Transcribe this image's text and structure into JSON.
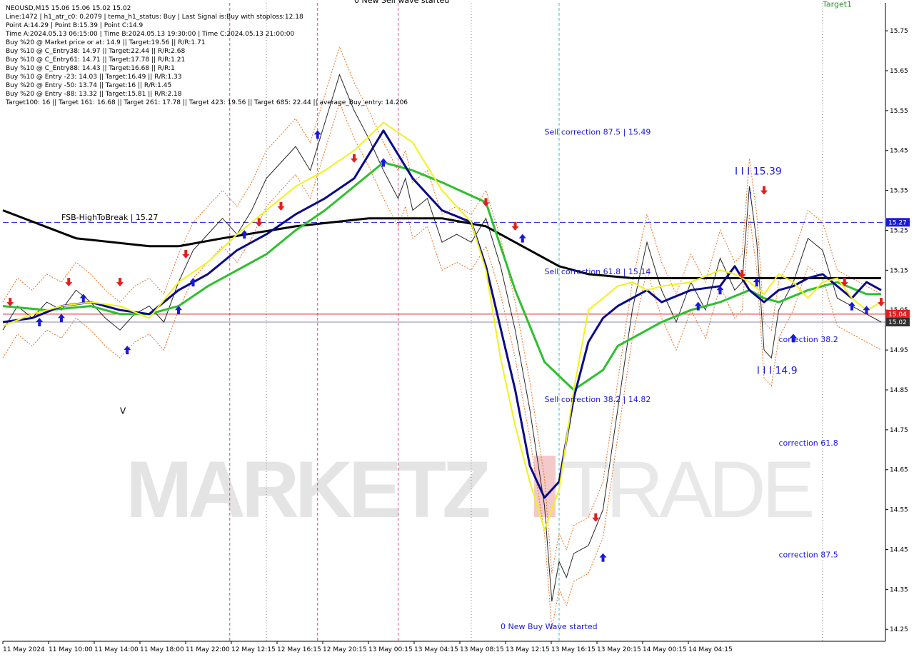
{
  "chart_data": {
    "type": "line",
    "symbol_header": "NEOUSD,M15  15.06 15.06 15.02 15.02",
    "info_lines": [
      "Line:1472 | h1_atr_c0: 0.2079 | tema_h1_status: Buy | Last Signal is:Buy with stoploss:12.18",
      "Point A:14.29 | Point B:15.39 | Point C:14.9",
      "Time A:2024.05.13 06:15:00 | Time B:2024.05.13 19:30:00 | Time C:2024.05.13 21:00:00",
      "Buy %20 @ Market price or at: 14.9 || Target:19.56 || R/R:1.71",
      "Buy %10 @ C_Entry38: 14.97 || Target:22.44 || R/R:2.68",
      "Buy %10 @ C_Entry61: 14.71 || Target:17.78 || R/R:1.21",
      "Buy %10 @ C_Entry88: 14.43 || Target:16.68 || R/R:1",
      "Buy %10 @ Entry -23: 14.03 || Target:16.49 || R/R:1.33",
      "Buy %20 @ Entry -50: 13.74 || Target:16 || R/R:1.45",
      "Buy %20 @ Entry -88: 13.32 || Target:15.81 || R/R:2.18",
      "Target100: 16 || Target 161: 16.68 || Target 261: 17.78 || Target 423: 19.56 || Target 685: 22.44 || average_Buy_entry: 14.206"
    ],
    "ylim": [
      14.22,
      15.82
    ],
    "y_ticks": [
      "15.75",
      "15.65",
      "15.55",
      "15.45",
      "15.35",
      "15.25",
      "15.15",
      "15.05",
      "14.95",
      "14.85",
      "14.75",
      "14.65",
      "14.55",
      "14.45",
      "14.35",
      "14.25"
    ],
    "x_ticks": [
      "11 May 2024",
      "11 May 10:00",
      "11 May 14:00",
      "11 May 18:00",
      "11 May 22:00",
      "12 May 12:15",
      "12 May 16:15",
      "12 May 20:15",
      "13 May 00:15",
      "13 May 04:15",
      "13 May 08:15",
      "13 May 12:15",
      "13 May 16:15",
      "13 May 20:15",
      "14 May 00:15",
      "14 May 04:15"
    ],
    "price_labels": [
      {
        "text": "15.27",
        "value": 15.27,
        "color": "#1a1ad6"
      },
      {
        "text": "15.04",
        "value": 15.04,
        "color": "#e02020"
      },
      {
        "text": "15.02",
        "value": 15.02,
        "color": "#303030"
      }
    ],
    "levels": [
      {
        "name": "FSB-HighToBreak",
        "value": 15.27,
        "color": "#1a1ad6",
        "style": "dashed"
      },
      {
        "name": "current-bid",
        "value": 15.04,
        "color": "#e02020",
        "style": "solid"
      },
      {
        "name": "current-ask",
        "value": 15.02,
        "color": "#8a8ab0",
        "style": "solid"
      }
    ],
    "annotations": [
      {
        "text": "0 New Sell wave started",
        "bar": 48,
        "value": 15.82,
        "color": "#000000"
      },
      {
        "text": "Target1",
        "bar": 112,
        "value": 15.81,
        "color": "#2e8b2e"
      },
      {
        "text": "Sell correction 87.5 | 15.49",
        "bar": 74,
        "value": 15.49,
        "color": "#1a1ad6"
      },
      {
        "text": "Sell correction 61.8 | 15.14",
        "bar": 74,
        "value": 15.14,
        "color": "#1a1ad6"
      },
      {
        "text": "Sell correction 38.2 | 14.82",
        "bar": 74,
        "value": 14.82,
        "color": "#1a1ad6"
      },
      {
        "text": "I I I 15.39",
        "bar": 100,
        "value": 15.39,
        "color": "#1a1ad6",
        "size": 14
      },
      {
        "text": "I",
        "bar": 102,
        "value": 15.33,
        "color": "#1a1ad6",
        "size": 12
      },
      {
        "text": "FSB-HighToBreak | 15.27",
        "bar": 8,
        "value": 15.276,
        "color": "#000000"
      },
      {
        "text": "correction 38.2",
        "bar": 106,
        "value": 14.97,
        "color": "#1a1ad6"
      },
      {
        "text": "I I I 14.9",
        "bar": 103,
        "value": 14.89,
        "color": "#1a1ad6",
        "size": 14
      },
      {
        "text": "correction 61.8",
        "bar": 106,
        "value": 14.71,
        "color": "#1a1ad6"
      },
      {
        "text": "correction 87.5",
        "bar": 106,
        "value": 14.43,
        "color": "#1a1ad6"
      },
      {
        "text": "0 New Buy Wave started",
        "bar": 68,
        "value": 14.25,
        "color": "#1a1ad6"
      },
      {
        "text": "V",
        "bar": 16,
        "value": 14.79,
        "color": "#000000",
        "size": 12
      }
    ],
    "watermark": {
      "left": "MARKETZ",
      "right": "TRADE"
    },
    "series": [
      {
        "name": "EMA-slow",
        "color": "#000000",
        "x": [
          0,
          10,
          20,
          24,
          30,
          40,
          50,
          56,
          60,
          66,
          72,
          76,
          80,
          86,
          90,
          94,
          100,
          106,
          112,
          118,
          120
        ],
        "y": [
          15.3,
          15.23,
          15.21,
          15.21,
          15.23,
          15.26,
          15.28,
          15.28,
          15.28,
          15.26,
          15.2,
          15.16,
          15.14,
          15.13,
          15.13,
          15.13,
          15.13,
          15.13,
          15.13,
          15.13,
          15.13
        ]
      },
      {
        "name": "EMA-mid",
        "color": "#2fbf2f",
        "x": [
          0,
          6,
          12,
          16,
          20,
          24,
          28,
          32,
          36,
          40,
          44,
          48,
          52,
          56,
          60,
          66,
          70,
          74,
          78,
          82,
          84,
          86,
          88,
          90,
          94,
          98,
          102,
          104,
          106,
          110,
          114,
          118,
          120
        ],
        "y": [
          15.06,
          15.05,
          15.06,
          15.04,
          15.04,
          15.06,
          15.11,
          15.15,
          15.19,
          15.25,
          15.3,
          15.36,
          15.42,
          15.4,
          15.37,
          15.32,
          15.1,
          14.92,
          14.85,
          14.9,
          14.96,
          14.98,
          15.0,
          15.02,
          15.05,
          15.07,
          15.1,
          15.08,
          15.07,
          15.1,
          15.12,
          15.09,
          15.09
        ]
      },
      {
        "name": "EMA-fast",
        "color": "#0a0a8a",
        "x": [
          0,
          4,
          8,
          12,
          16,
          20,
          24,
          28,
          32,
          36,
          40,
          44,
          48,
          52,
          56,
          60,
          64,
          66,
          70,
          72,
          74,
          76,
          78,
          80,
          82,
          84,
          86,
          88,
          90,
          94,
          98,
          100,
          102,
          104,
          106,
          108,
          110,
          112,
          114,
          116,
          118,
          120
        ],
        "y": [
          15.02,
          15.03,
          15.06,
          15.07,
          15.05,
          15.04,
          15.1,
          15.14,
          15.2,
          15.24,
          15.29,
          15.33,
          15.38,
          15.5,
          15.38,
          15.3,
          15.27,
          15.16,
          14.85,
          14.66,
          14.58,
          14.62,
          14.83,
          14.97,
          15.03,
          15.06,
          15.08,
          15.1,
          15.07,
          15.1,
          15.11,
          15.16,
          15.1,
          15.07,
          15.1,
          15.11,
          15.13,
          15.14,
          15.11,
          15.08,
          15.12,
          15.1
        ]
      },
      {
        "name": "TEMA",
        "color": "#f2f21a",
        "x": [
          0,
          4,
          8,
          12,
          16,
          20,
          24,
          28,
          32,
          36,
          40,
          44,
          48,
          52,
          56,
          60,
          64,
          66,
          68,
          70,
          72,
          74,
          76,
          78,
          80,
          82,
          84,
          86,
          88,
          90,
          94,
          98,
          100,
          102,
          104,
          106,
          108,
          110,
          112,
          114,
          116,
          118,
          120
        ],
        "y": [
          15.01,
          15.04,
          15.06,
          15.07,
          15.06,
          15.03,
          15.12,
          15.17,
          15.24,
          15.3,
          15.36,
          15.4,
          15.45,
          15.52,
          15.47,
          15.35,
          15.27,
          15.15,
          14.93,
          14.76,
          14.62,
          14.5,
          14.6,
          14.85,
          15.05,
          15.08,
          15.11,
          15.12,
          15.1,
          15.11,
          15.12,
          15.15,
          15.14,
          15.12,
          15.09,
          15.14,
          15.12,
          15.08,
          15.12,
          15.13,
          15.08,
          15.05,
          15.07
        ]
      }
    ],
    "price_path": {
      "name": "price",
      "color": "#000000",
      "x": [
        0,
        2,
        4,
        6,
        8,
        10,
        12,
        14,
        16,
        18,
        20,
        22,
        24,
        26,
        28,
        30,
        32,
        34,
        36,
        38,
        40,
        42,
        44,
        46,
        48,
        50,
        52,
        54,
        55,
        56,
        58,
        60,
        62,
        64,
        66,
        68,
        70,
        72,
        74,
        75,
        76,
        77,
        78,
        80,
        82,
        84,
        86,
        88,
        90,
        92,
        94,
        96,
        98,
        100,
        101,
        102,
        103,
        104,
        105,
        106,
        108,
        110,
        112,
        114,
        116,
        118,
        120
      ],
      "y": [
        15.0,
        15.06,
        15.03,
        15.07,
        15.05,
        15.1,
        15.07,
        15.03,
        15.0,
        15.04,
        15.06,
        15.02,
        15.12,
        15.2,
        15.24,
        15.28,
        15.24,
        15.3,
        15.38,
        15.42,
        15.46,
        15.4,
        15.52,
        15.64,
        15.55,
        15.48,
        15.4,
        15.33,
        15.38,
        15.3,
        15.33,
        15.22,
        15.24,
        15.22,
        15.28,
        15.16,
        15.0,
        14.8,
        14.56,
        14.32,
        14.42,
        14.38,
        14.44,
        14.46,
        14.55,
        14.8,
        15.05,
        15.22,
        15.1,
        15.02,
        15.12,
        15.05,
        15.18,
        15.1,
        15.12,
        15.36,
        15.22,
        14.95,
        14.93,
        15.05,
        15.12,
        15.23,
        15.2,
        15.08,
        15.06,
        15.04,
        15.02
      ]
    },
    "arrows": [
      {
        "bar": 1,
        "value": 15.07,
        "dir": "down",
        "color": "#e02020"
      },
      {
        "bar": 5,
        "value": 15.02,
        "dir": "up",
        "color": "#1a1ad6"
      },
      {
        "bar": 8,
        "value": 15.03,
        "dir": "up",
        "color": "#1a1ad6"
      },
      {
        "bar": 9,
        "value": 15.12,
        "dir": "down",
        "color": "#e02020"
      },
      {
        "bar": 11,
        "value": 15.08,
        "dir": "up",
        "color": "#1a1ad6"
      },
      {
        "bar": 16,
        "value": 15.12,
        "dir": "down",
        "color": "#e02020"
      },
      {
        "bar": 17,
        "value": 14.95,
        "dir": "up",
        "color": "#1a1ad6"
      },
      {
        "bar": 24,
        "value": 15.05,
        "dir": "up",
        "color": "#1a1ad6"
      },
      {
        "bar": 25,
        "value": 15.19,
        "dir": "down",
        "color": "#e02020"
      },
      {
        "bar": 26,
        "value": 15.12,
        "dir": "up",
        "color": "#1a1ad6"
      },
      {
        "bar": 33,
        "value": 15.24,
        "dir": "up",
        "color": "#1a1ad6"
      },
      {
        "bar": 35,
        "value": 15.27,
        "dir": "down",
        "color": "#e02020"
      },
      {
        "bar": 38,
        "value": 15.31,
        "dir": "down",
        "color": "#e02020"
      },
      {
        "bar": 43,
        "value": 15.49,
        "dir": "up",
        "color": "#1a1ad6"
      },
      {
        "bar": 48,
        "value": 15.43,
        "dir": "down",
        "color": "#e02020"
      },
      {
        "bar": 52,
        "value": 15.42,
        "dir": "up",
        "color": "#1a1ad6"
      },
      {
        "bar": 66,
        "value": 15.32,
        "dir": "down",
        "color": "#e02020"
      },
      {
        "bar": 70,
        "value": 15.26,
        "dir": "down",
        "color": "#e02020"
      },
      {
        "bar": 71,
        "value": 15.23,
        "dir": "up",
        "color": "#1a1ad6"
      },
      {
        "bar": 81,
        "value": 14.53,
        "dir": "down",
        "color": "#e02020"
      },
      {
        "bar": 82,
        "value": 14.43,
        "dir": "up",
        "color": "#1a1ad6"
      },
      {
        "bar": 95,
        "value": 15.06,
        "dir": "up",
        "color": "#1a1ad6"
      },
      {
        "bar": 98,
        "value": 15.1,
        "dir": "up",
        "color": "#1a1ad6"
      },
      {
        "bar": 101,
        "value": 15.14,
        "dir": "down",
        "color": "#e02020"
      },
      {
        "bar": 103,
        "value": 15.12,
        "dir": "up",
        "color": "#1a1ad6"
      },
      {
        "bar": 104,
        "value": 15.35,
        "dir": "down",
        "color": "#e02020"
      },
      {
        "bar": 108,
        "value": 14.98,
        "dir": "up",
        "color": "#1a1ad6"
      },
      {
        "bar": 115,
        "value": 15.12,
        "dir": "down",
        "color": "#e02020"
      },
      {
        "bar": 116,
        "value": 15.06,
        "dir": "up",
        "color": "#1a1ad6"
      },
      {
        "bar": 118,
        "value": 15.05,
        "dir": "up",
        "color": "#1a1ad6"
      },
      {
        "bar": 120,
        "value": 15.07,
        "dir": "down",
        "color": "#e02020"
      }
    ],
    "vertical_markers": [
      {
        "bar": 31,
        "color": "#e04080",
        "style": "dashed"
      },
      {
        "bar": 36,
        "color": "#808080",
        "style": "dotted"
      },
      {
        "bar": 43,
        "color": "#e04080",
        "style": "dashed"
      },
      {
        "bar": 54,
        "color": "#e04080",
        "style": "dashed"
      },
      {
        "bar": 64,
        "color": "#808080",
        "style": "dotted"
      },
      {
        "bar": 76,
        "color": "#30c0c0",
        "style": "dashed"
      },
      {
        "bar": 112,
        "color": "#808080",
        "style": "dotted"
      }
    ],
    "bars_total": 121,
    "grid": false,
    "colors": {
      "up": "#1a1ad6",
      "down": "#e02020",
      "background": "#ffffff",
      "axis": "#000000"
    }
  }
}
